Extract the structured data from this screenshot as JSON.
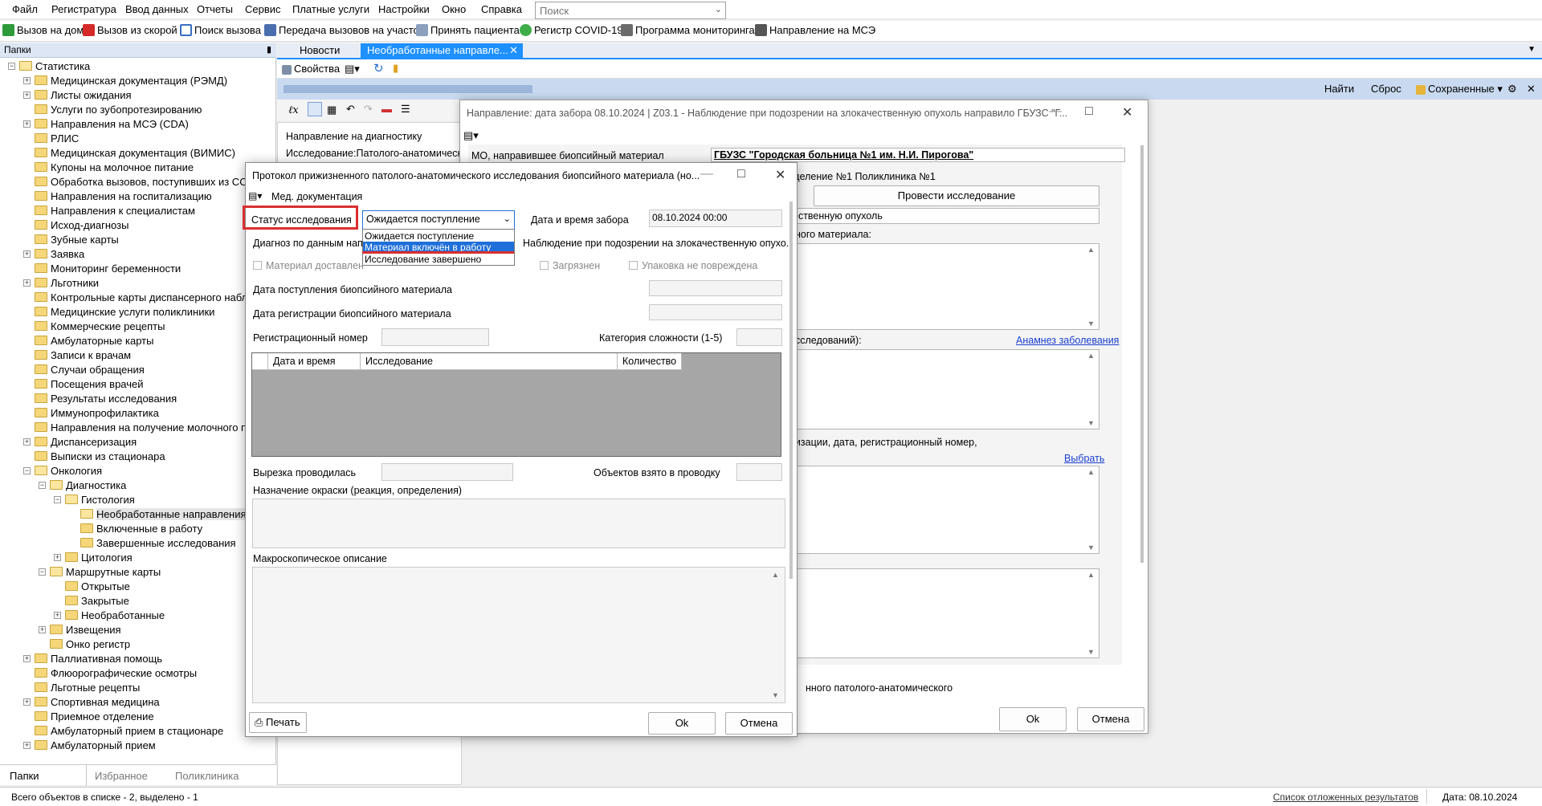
{
  "menu": [
    "Файл",
    "Регистратура",
    "Ввод данных",
    "Отчеты",
    "Сервис",
    "Платные услуги",
    "Настройки",
    "Окно",
    "Справка"
  ],
  "search": {
    "placeholder": "Поиск"
  },
  "toolbar": {
    "home_visit": "Вызов на дом",
    "ambulance_call": "Вызов из скорой",
    "find_call": "Поиск вызова",
    "transfer_calls": "Передача вызовов на участок",
    "accept_patient": "Принять пациента",
    "covid_registry": "Регистр COVID-19",
    "monitoring": "Программа мониторинга",
    "mse": "Направление на МСЭ"
  },
  "left_panel": {
    "title": "Папки",
    "tree": [
      {
        "label": "Статистика",
        "level": 0,
        "exp": "-",
        "open": true
      },
      {
        "label": "Медицинская документация (РЭМД)",
        "level": 1,
        "exp": "+"
      },
      {
        "label": "Листы ожидания",
        "level": 1,
        "exp": "+"
      },
      {
        "label": "Услуги по зубопротезированию",
        "level": 1,
        "exp": ""
      },
      {
        "label": "Направления на МСЭ (CDA)",
        "level": 1,
        "exp": "+"
      },
      {
        "label": "РЛИС",
        "level": 1,
        "exp": ""
      },
      {
        "label": "Медицинская документация (ВИМИС)",
        "level": 1,
        "exp": ""
      },
      {
        "label": "Купоны на молочное питание",
        "level": 1,
        "exp": ""
      },
      {
        "label": "Обработка вызовов, поступивших из ССМП",
        "level": 1,
        "exp": ""
      },
      {
        "label": "Направления на госпитализацию",
        "level": 1,
        "exp": ""
      },
      {
        "label": "Направления к специалистам",
        "level": 1,
        "exp": ""
      },
      {
        "label": "Исход-диагнозы",
        "level": 1,
        "exp": ""
      },
      {
        "label": "Зубные карты",
        "level": 1,
        "exp": ""
      },
      {
        "label": "Заявка",
        "level": 1,
        "exp": "+"
      },
      {
        "label": "Мониторинг беременности",
        "level": 1,
        "exp": ""
      },
      {
        "label": "Льготники",
        "level": 1,
        "exp": "+"
      },
      {
        "label": "Контрольные карты диспансерного наблюдения",
        "level": 1,
        "exp": ""
      },
      {
        "label": "Медицинские услуги поликлиники",
        "level": 1,
        "exp": ""
      },
      {
        "label": "Коммерческие рецепты",
        "level": 1,
        "exp": ""
      },
      {
        "label": "Амбулаторные карты",
        "level": 1,
        "exp": ""
      },
      {
        "label": "Записи к врачам",
        "level": 1,
        "exp": ""
      },
      {
        "label": "Случаи обращения",
        "level": 1,
        "exp": ""
      },
      {
        "label": "Посещения врачей",
        "level": 1,
        "exp": ""
      },
      {
        "label": "Результаты исследования",
        "level": 1,
        "exp": ""
      },
      {
        "label": "Иммунопрофилактика",
        "level": 1,
        "exp": ""
      },
      {
        "label": "Направления на получение молочного питания",
        "level": 1,
        "exp": ""
      },
      {
        "label": "Диспансеризация",
        "level": 1,
        "exp": "+"
      },
      {
        "label": "Выписки из стационара",
        "level": 1,
        "exp": ""
      },
      {
        "label": "Онкология",
        "level": 1,
        "exp": "-",
        "open": true
      },
      {
        "label": "Диагностика",
        "level": 2,
        "exp": "-",
        "open": true
      },
      {
        "label": "Гистология",
        "level": 3,
        "exp": "-",
        "open": true
      },
      {
        "label": "Необработанные направления",
        "level": 4,
        "exp": "",
        "selected": true,
        "open": true
      },
      {
        "label": "Включенные в работу",
        "level": 4,
        "exp": ""
      },
      {
        "label": "Завершенные исследования",
        "level": 4,
        "exp": ""
      },
      {
        "label": "Цитология",
        "level": 3,
        "exp": "+"
      },
      {
        "label": "Маршрутные карты",
        "level": 2,
        "exp": "-",
        "open": true
      },
      {
        "label": "Открытые",
        "level": 3,
        "exp": ""
      },
      {
        "label": "Закрытые",
        "level": 3,
        "exp": ""
      },
      {
        "label": "Необработанные",
        "level": 3,
        "exp": "+"
      },
      {
        "label": "Извещения",
        "level": 2,
        "exp": "+"
      },
      {
        "label": "Онко регистр",
        "level": 2,
        "exp": ""
      },
      {
        "label": "Паллиативная помощь",
        "level": 1,
        "exp": "+"
      },
      {
        "label": "Флюорографические осмотры",
        "level": 1,
        "exp": ""
      },
      {
        "label": "Льготные рецепты",
        "level": 1,
        "exp": ""
      },
      {
        "label": "Спортивная медицина",
        "level": 1,
        "exp": "+"
      },
      {
        "label": "Приемное отделение",
        "level": 1,
        "exp": ""
      },
      {
        "label": "Амбулаторный прием в стационаре",
        "level": 1,
        "exp": ""
      },
      {
        "label": "Амбулаторный прием",
        "level": 1,
        "exp": "+"
      }
    ],
    "bottom_tabs": [
      "Папки",
      "Избранное",
      "Поликлиника"
    ]
  },
  "tabs": [
    {
      "label": "Новости"
    },
    {
      "label": "Необработанные направле...",
      "close": "✕"
    }
  ],
  "doc_toolbar": {
    "properties": "Свойства"
  },
  "blue_bar": {
    "find": "Найти",
    "reset": "Сброс",
    "saved": "Сохраненные"
  },
  "detail": {
    "line1": "Направление на диагностику",
    "line2": "Исследование:Патолого-анатомическое"
  },
  "win2": {
    "title": "Направление: дата забора 08.10.2024 | Z03.1 - Наблюдение при подозрении на злокачественную опухоль направило ГБУЗС \"Г...",
    "mo_label": "МО, направившее биопсийный материал",
    "mo_value": "ГБУЗС \"Городская больница №1 им. Н.И. Пирогова\"",
    "dept_fragment": "тделение №1 Поликлиника №1",
    "conduct_btn": "Провести исследование",
    "diag_fragment": "ественную опухоль",
    "material_fragment": "йного материала:",
    "research_fragment": "исследований):",
    "anamnesis_link": "Анамнез заболевания",
    "org_fragment": "низации, дата, регистрационный номер,",
    "choose_link": "Выбрать",
    "bottom_fragment": "нного патолого-анатомического",
    "ok": "Ok",
    "cancel": "Отмена"
  },
  "win1": {
    "title": "Протокол прижизненного патолого-анатомического исследования биопсийного материала (но...",
    "menu": "Мед. документация",
    "status_label": "Статус исследования",
    "status_value": "Ожидается поступление",
    "status_options": [
      "Ожидается поступление",
      "Материал включён в работу",
      "Исследование завершено"
    ],
    "collect_label": "Дата и время забора",
    "collect_value": "08.10.2024 00:00",
    "diag_label": "Диагноз по данным напр",
    "diag_value": "Наблюдение при подозрении на злокачественную опухо.",
    "chk_delivered": "Материал доставлен",
    "chk_dirty": "Загрязнен",
    "chk_package": "Упаковка не повреждена",
    "arrival_label": "Дата поступления биопсийного материала",
    "register_label": "Дата регистрации биопсийного материала",
    "regnum_label": "Регистрационный номер",
    "complexity_label": "Категория сложности (1-5)",
    "grid_cols": [
      "Дата и время",
      "Исследование",
      "Количество"
    ],
    "cut_label": "Вырезка проводилась",
    "objects_label": "Объектов взято в проводку",
    "stain_label": "Назначение окраски (реакция, определения)",
    "macro_label": "Макроскопическое описание",
    "print": "Печать",
    "ok": "Ok",
    "cancel": "Отмена"
  },
  "statusbar": {
    "left": "Всего объектов в списке - 2, выделено - 1",
    "deferred": "Список отложенных результатов",
    "date": "Дата: 08.10.2024"
  },
  "colors": {
    "accent": "#1e90ff",
    "highlight_red": "#d9302f",
    "select_blue": "#1e6fd9"
  }
}
